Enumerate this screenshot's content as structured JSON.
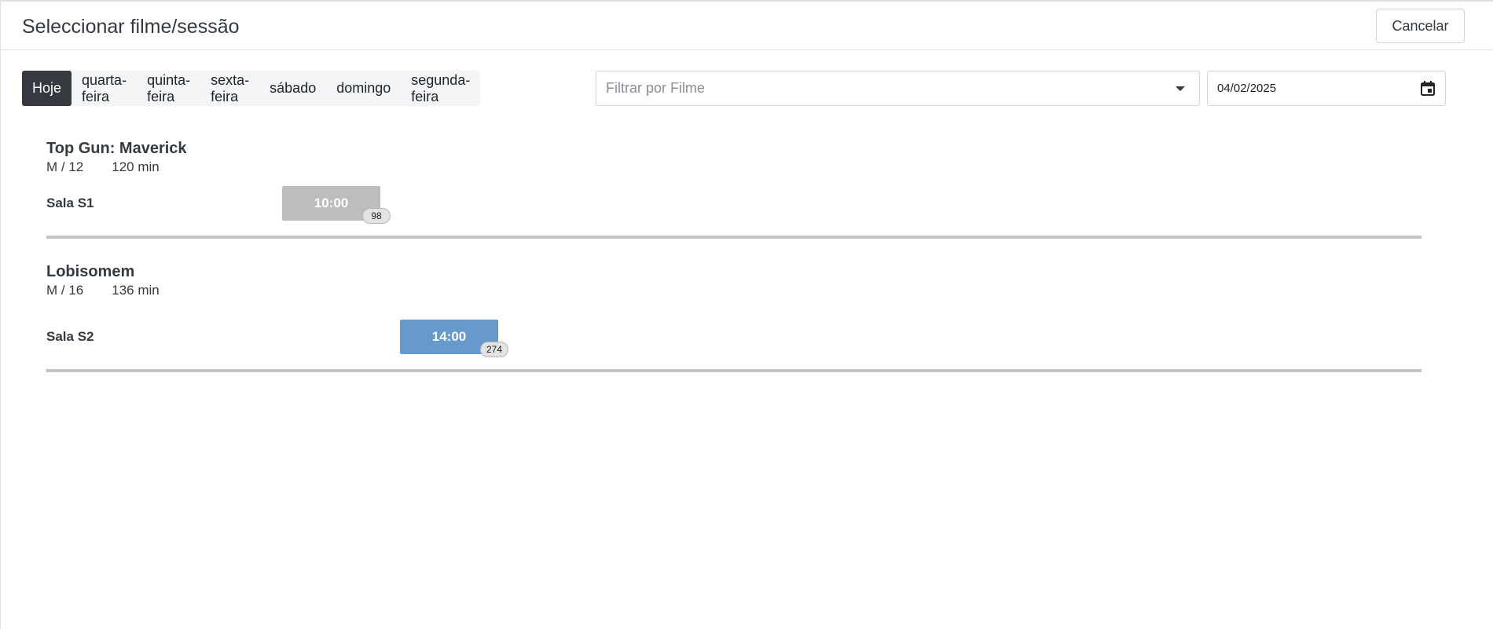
{
  "header": {
    "title": "Seleccionar filme/sessão",
    "cancel_label": "Cancelar"
  },
  "days": [
    {
      "label": "Hoje",
      "active": true
    },
    {
      "label": "quarta-feira",
      "active": false
    },
    {
      "label": "quinta-feira",
      "active": false
    },
    {
      "label": "sexta-feira",
      "active": false
    },
    {
      "label": "sábado",
      "active": false
    },
    {
      "label": "domingo",
      "active": false
    },
    {
      "label": "segunda-feira",
      "active": false
    }
  ],
  "filter": {
    "placeholder": "Filtrar por Filme",
    "icon": "chevron-down-icon"
  },
  "date": {
    "value": "04/02/2025",
    "icon": "calendar-icon"
  },
  "movies": [
    {
      "title": "Top Gun: Maverick",
      "rating": "M / 12",
      "duration": "120 min",
      "rooms": [
        {
          "name": "Sala S1",
          "sessions": [
            {
              "time": "10:00",
              "seats": "98",
              "state": "past"
            }
          ]
        }
      ]
    },
    {
      "title": "Lobisomem",
      "rating": "M / 16",
      "duration": "136 min",
      "rooms": [
        {
          "name": "Sala S2",
          "sessions": [
            {
              "time": "14:00",
              "seats": "274",
              "state": "open"
            }
          ]
        }
      ]
    }
  ],
  "colors": {
    "active_tab": "#343a40",
    "session_past": "#bdbdbd",
    "session_open": "#6699cc"
  }
}
